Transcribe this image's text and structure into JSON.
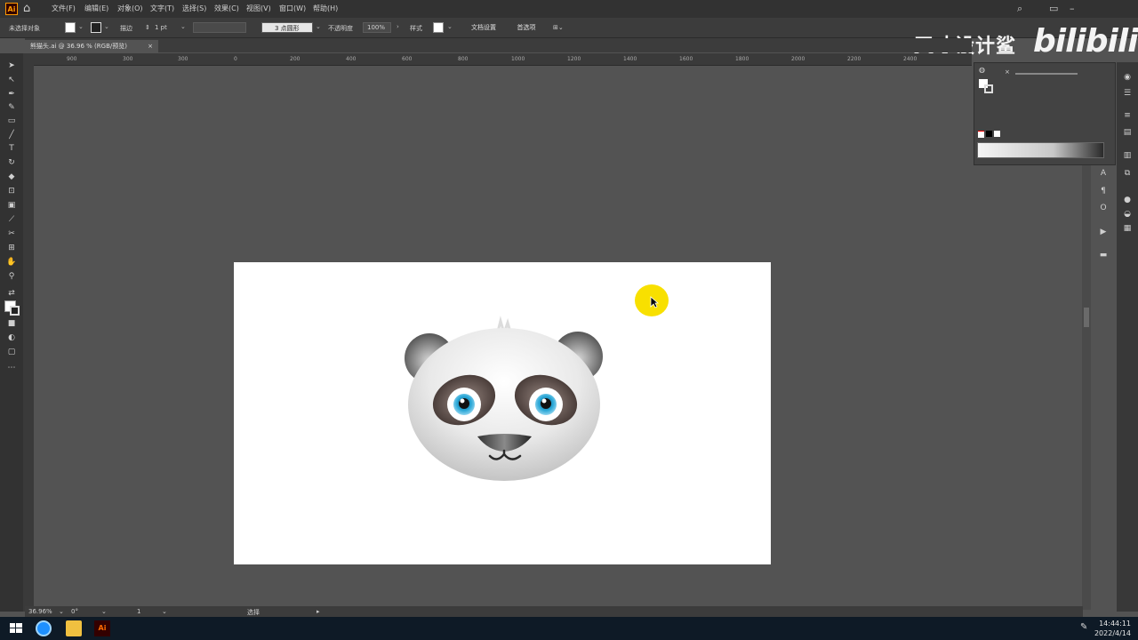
{
  "menubar": {
    "app_icon": "Ai",
    "home_icon": "home-icon",
    "items": [
      "文件(F)",
      "编辑(E)",
      "对象(O)",
      "文字(T)",
      "选择(S)",
      "效果(C)",
      "视图(V)",
      "窗口(W)",
      "帮助(H)"
    ]
  },
  "controlbar": {
    "left_label": "未选择对象",
    "stroke_label": "描边",
    "stroke_value": "1 pt",
    "brush_label": "3 点圆形",
    "opacity_label": "不透明度",
    "opacity_value": "100%",
    "style_label": "样式",
    "doc_setup_button": "文档设置",
    "preferences_button": "首选项"
  },
  "document_tab": {
    "title": "熊猫头.ai @ 36.96 % (RGB/预览)",
    "close": "×"
  },
  "ruler": {
    "ticks": [
      "900",
      "300",
      "300",
      "0",
      "200",
      "400",
      "600",
      "800",
      "1000",
      "1200",
      "1400",
      "1600",
      "1800",
      "2000",
      "2200",
      "2400"
    ]
  },
  "statusbar": {
    "zoom": "36.96%",
    "rotation": "0°",
    "artboard_number": "1",
    "tool": "选择"
  },
  "watermark": {
    "text": "天才设计鲨",
    "logo": "bilibili"
  },
  "taskbar": {
    "time": "14:44:11",
    "date": "2022/4/14"
  },
  "colors": {
    "accent_highlight": "#f8e000",
    "panda_iris": "#2aa7d6",
    "workspace": "#535353"
  }
}
